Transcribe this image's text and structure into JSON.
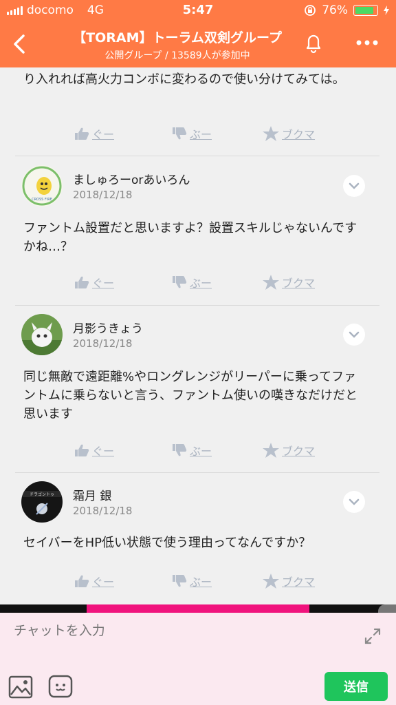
{
  "status": {
    "carrier": "docomo",
    "network": "4G",
    "time": "5:47",
    "battery": "76%",
    "battery_level": 0.76
  },
  "header": {
    "title": "【TORAM】トーラム双剣グループ",
    "subtitle": "公開グループ / 13589人が参加中"
  },
  "actions": {
    "like": "ぐー",
    "dislike": "ぶー",
    "bookmark": "ブクマ"
  },
  "top_text": "り入れれば高火力コンボに変わるので使い分けてみては。",
  "posts": [
    {
      "name": "ましゅろーorあいろん",
      "date": "2018/12/18",
      "text": "ファントム設置だと思いますよ？設置スキルじゃないんですかね…？",
      "avatar_text": "CROSS FIRE"
    },
    {
      "name": "月影うきょう",
      "date": "2018/12/18",
      "text": "同じ無敵で遠距離%やロングレンジがリーパーに乗ってファントムに乗らないと言う、ファントム使いの嘆きなだけだと思います"
    },
    {
      "name": "霜月 銀",
      "date": "2018/12/18",
      "text": "セイバーをHP低い状態で使う理由ってなんですか？",
      "avatar_text": "ドラゴントゥ"
    }
  ],
  "chat": {
    "placeholder": "チャットを入力",
    "send_label": "送信"
  },
  "colors": {
    "brand": "#ff7a45",
    "send": "#1fc55c",
    "accent_bar": "#f0137d"
  }
}
